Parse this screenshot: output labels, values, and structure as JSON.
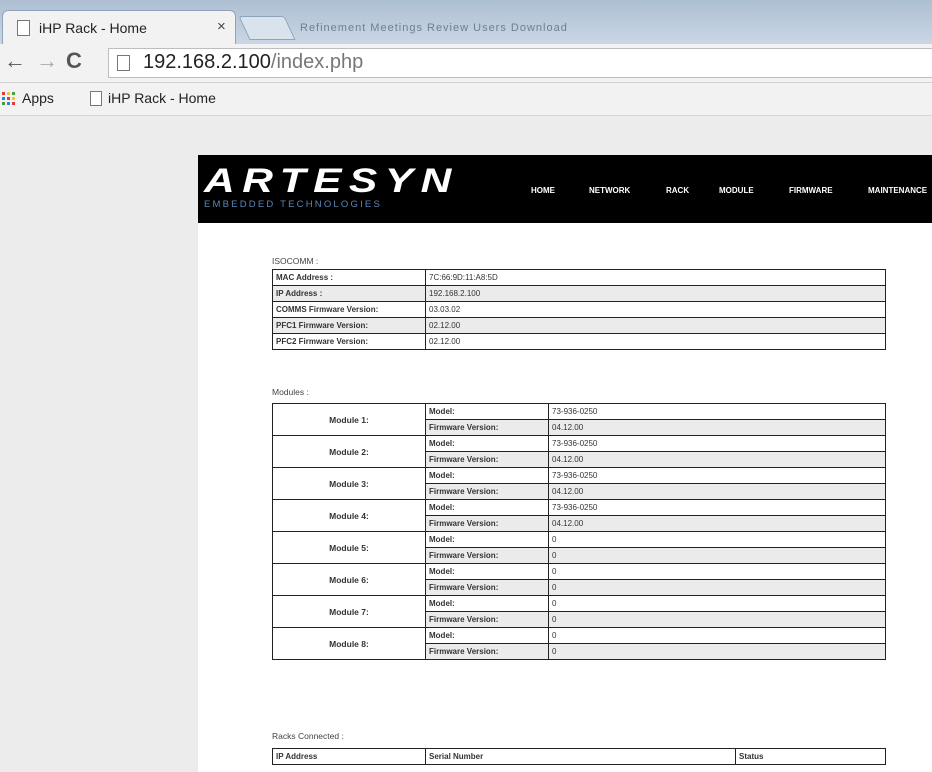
{
  "browser": {
    "tab_title": "iHP Rack - Home",
    "tab_close": "×",
    "blurred_tabs": "Refinement   Meetings   Review   Users   Download",
    "url_host": "192.168.2.100",
    "url_path": "/index.php",
    "bookmarks": {
      "apps": "Apps",
      "page": "iHP Rack - Home"
    }
  },
  "header": {
    "logo_main": "ARTESYN",
    "logo_sub": "EMBEDDED TECHNOLOGIES",
    "menu": [
      "HOME",
      "NETWORK",
      "RACK",
      "MODULE",
      "FIRMWARE",
      "MAINTENANCE"
    ]
  },
  "isocomm": {
    "label": "ISOCOMM :",
    "rows": [
      {
        "key": "MAC Address :",
        "value": "7C:66:9D:11:A8:5D"
      },
      {
        "key": "IP Address :",
        "value": "192.168.2.100"
      },
      {
        "key": "COMMS Firmware Version:",
        "value": "03.03.02"
      },
      {
        "key": "PFC1 Firmware Version:",
        "value": "02.12.00"
      },
      {
        "key": "PFC2 Firmware Version:",
        "value": "02.12.00"
      }
    ]
  },
  "modules": {
    "label": "Modules :",
    "model_label": "Model:",
    "fw_label": "Firmware Version:",
    "items": [
      {
        "name": "Module 1:",
        "model": "73-936-0250",
        "firmware": "04.12.00"
      },
      {
        "name": "Module 2:",
        "model": "73-936-0250",
        "firmware": "04.12.00"
      },
      {
        "name": "Module 3:",
        "model": "73-936-0250",
        "firmware": "04.12.00"
      },
      {
        "name": "Module 4:",
        "model": "73-936-0250",
        "firmware": "04.12.00"
      },
      {
        "name": "Module 5:",
        "model": "0",
        "firmware": "0"
      },
      {
        "name": "Module 6:",
        "model": "0",
        "firmware": "0"
      },
      {
        "name": "Module 7:",
        "model": "0",
        "firmware": "0"
      },
      {
        "name": "Module 8:",
        "model": "0",
        "firmware": "0"
      }
    ]
  },
  "racks": {
    "label": "Racks Connected :",
    "headers": [
      "IP Address",
      "Serial Number",
      "Status"
    ]
  },
  "colors": {
    "header_bg": "#000000",
    "logo_sub": "#5a86b8",
    "row_alt": "#ebebeb"
  }
}
